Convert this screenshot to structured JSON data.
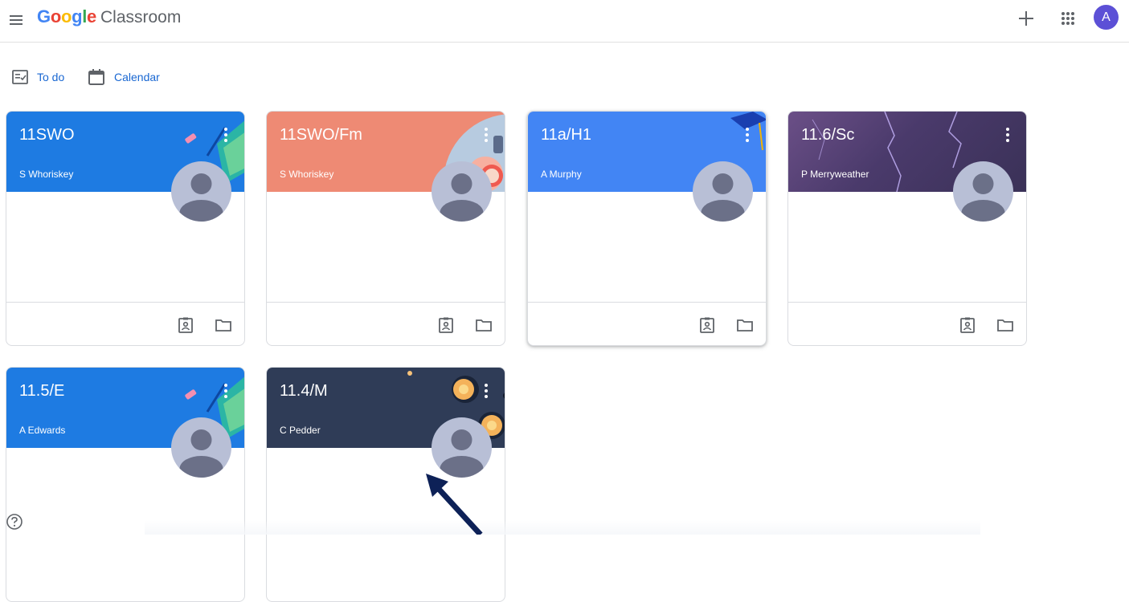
{
  "app": {
    "logo_google": "Google",
    "logo_product": "Classroom",
    "avatar_letter": "A"
  },
  "subnav": {
    "todo": "To do",
    "calendar": "Calendar"
  },
  "colors": {
    "accent": "#1967d2",
    "avatar": "#5c50d6"
  },
  "cards": [
    {
      "title": "11SWO",
      "teacher": "S Whoriskey",
      "theme": "#1e7be2"
    },
    {
      "title": "11SWO/Fm",
      "teacher": "S Whoriskey",
      "theme": "#ee8a74"
    },
    {
      "title": "11a/H1",
      "teacher": "A Murphy",
      "theme": "#4285f4"
    },
    {
      "title": "11.6/Sc",
      "teacher": "P Merryweather",
      "theme": "#4a3a6b"
    },
    {
      "title": "11.5/E",
      "teacher": "A Edwards",
      "theme": "#1e7be2"
    },
    {
      "title": "11.4/M",
      "teacher": "C Pedder",
      "theme": "#2f3c57"
    }
  ]
}
